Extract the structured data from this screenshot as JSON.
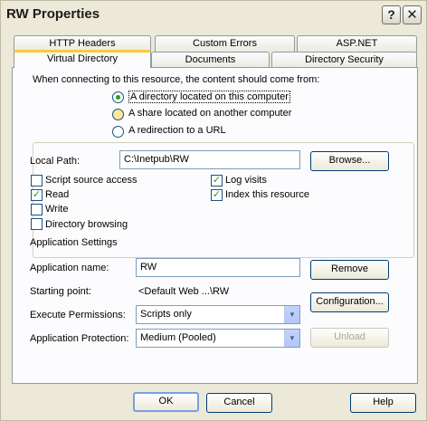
{
  "window": {
    "title": "RW Properties",
    "help_glyph": "?",
    "close_glyph": "✕"
  },
  "tabs": {
    "row1": [
      "HTTP Headers",
      "Custom Errors",
      "ASP.NET"
    ],
    "row2": [
      "Virtual Directory",
      "Documents",
      "Directory Security"
    ],
    "active": "Virtual Directory"
  },
  "content_source": {
    "prompt": "When connecting to this resource, the content should come from:",
    "options": [
      "A directory located on this computer",
      "A share located on another computer",
      "A redirection to a URL"
    ],
    "selected": "A directory located on this computer"
  },
  "local_path": {
    "label": "Local Path:",
    "value": "C:\\Inetpub\\RW",
    "browse_label": "Browse..."
  },
  "permissions": {
    "script_source_access": {
      "label": "Script source access",
      "checked": false
    },
    "read": {
      "label": "Read",
      "checked": true
    },
    "write": {
      "label": "Write",
      "checked": false
    },
    "directory_browsing": {
      "label": "Directory browsing",
      "checked": false
    },
    "log_visits": {
      "label": "Log visits",
      "checked": true
    },
    "index_resource": {
      "label": "Index this resource",
      "checked": true
    }
  },
  "app_settings": {
    "heading": "Application Settings",
    "name_label": "Application name:",
    "name_value": "RW",
    "remove_label": "Remove",
    "starting_point_label": "Starting point:",
    "starting_point_value": "<Default Web ...\\RW",
    "configuration_label": "Configuration...",
    "execute_label": "Execute Permissions:",
    "execute_value": "Scripts only",
    "protection_label": "Application Protection:",
    "protection_value": "Medium (Pooled)",
    "unload_label": "Unload"
  },
  "footer": {
    "ok_label": "OK",
    "cancel_label": "Cancel",
    "help_label": "Help"
  },
  "check_glyph": "✓",
  "arrow_glyph": "▼"
}
